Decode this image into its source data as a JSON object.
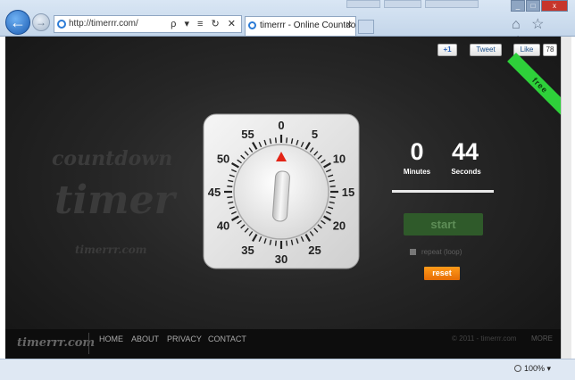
{
  "browser": {
    "address": "http://timerrr.com/",
    "address_icons": "ρ ▾ ≡ ↻ ✕",
    "tab_title": "timerrr - Online Countdown...",
    "tab_close": "✕",
    "tool_icons": "⌂ ☆ ⚙",
    "zoom": "100%"
  },
  "social": {
    "gplus": "+1",
    "tweet": "Tweet",
    "like": "Like",
    "like_count": "78"
  },
  "ribbon": "free",
  "ghost_logo": {
    "line1": "countdown",
    "line2": "timer",
    "line3": "timerrr.com"
  },
  "dial": {
    "labels": [
      "0",
      "5",
      "10",
      "15",
      "20",
      "25",
      "30",
      "35",
      "40",
      "45",
      "50",
      "55"
    ]
  },
  "timer": {
    "minutes": "0",
    "seconds": "44",
    "minutes_label": "Minutes",
    "seconds_label": "Seconds",
    "start": "start",
    "repeat": "repeat (loop)",
    "reset": "reset"
  },
  "footer": {
    "logo": "timerrr.com",
    "links": [
      "HOME",
      "ABOUT",
      "PRIVACY",
      "CONTACT"
    ],
    "copyright": "© 2011 - timerrr.com",
    "more": "MORE"
  },
  "colors": {
    "accent_green": "#2ed03a",
    "reset_orange": "#f08a10",
    "pointer_red": "#e32416"
  }
}
